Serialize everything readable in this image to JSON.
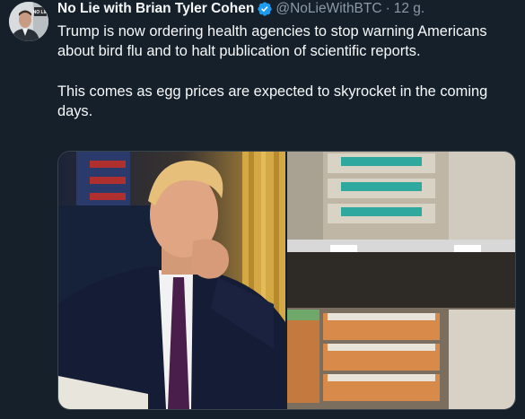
{
  "tweet": {
    "author_name": "No Lie with Brian Tyler Cohen",
    "handle": "@NoLieWithBTC",
    "separator": "·",
    "time": "12 g.",
    "verified": true,
    "avatar_badge": "NO LIE",
    "text_paragraphs": [
      "Trump is now ordering health agencies to stop warning Americans about bird flu and to halt publication of scientific reports.",
      "This comes as egg prices are expected to skyrocket in the coming days."
    ]
  },
  "media": {
    "photos": [
      {
        "subject": "man in suit with hand on chin"
      },
      {
        "subject": "grocery shelves of egg cartons with price tags"
      }
    ]
  },
  "colors": {
    "background": "#15202b",
    "text_primary": "#f7f9f9",
    "text_secondary": "#8b98a5",
    "verified_blue": "#1d9bf0",
    "border": "#38444d"
  },
  "icons": [
    "verified-badge-icon"
  ]
}
